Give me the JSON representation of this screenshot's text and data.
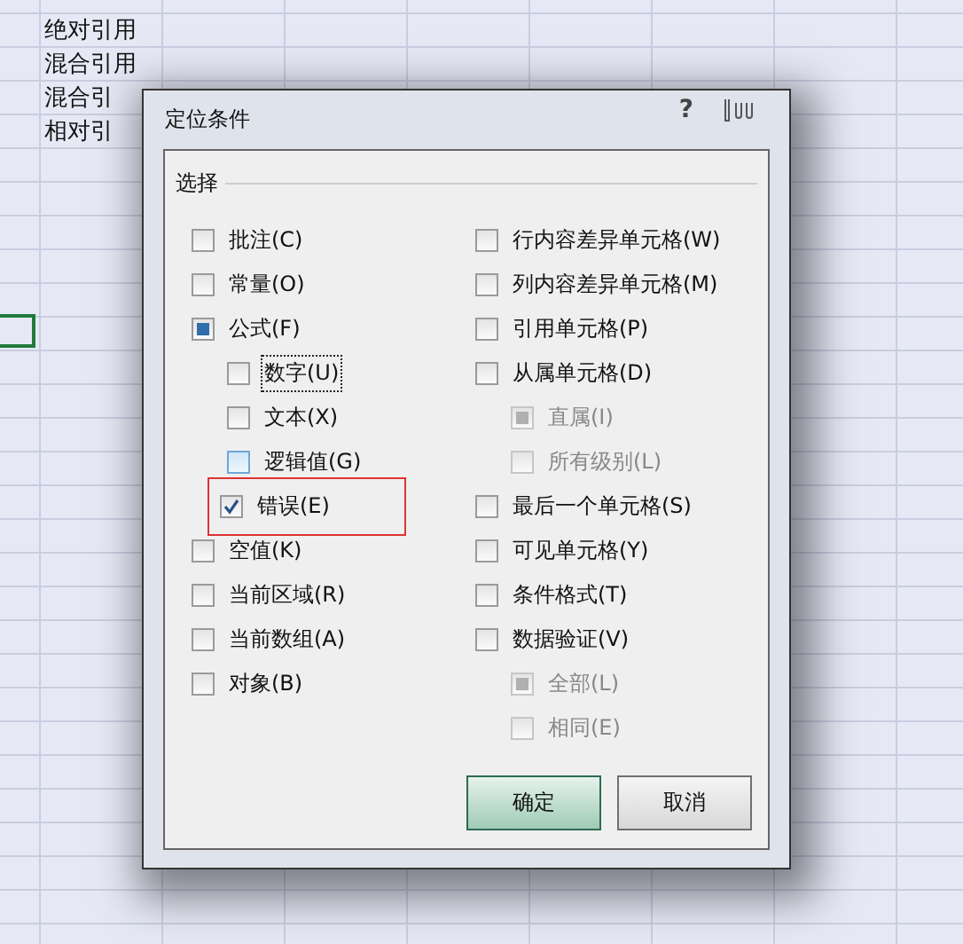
{
  "sheet": {
    "cells": [
      "绝对引用",
      "混合引用",
      "混合引",
      "相对引"
    ]
  },
  "dialog": {
    "title": "定位条件",
    "help": "?",
    "group_label": "选择",
    "left": [
      {
        "label": "批注(C)",
        "checked": false,
        "mixed": false,
        "disabled": false,
        "focused": false,
        "hovered": false,
        "highlighted": false
      },
      {
        "label": "常量(O)",
        "checked": false,
        "mixed": false,
        "disabled": false,
        "focused": false,
        "hovered": false,
        "highlighted": false
      },
      {
        "label": "公式(F)",
        "checked": false,
        "mixed": true,
        "disabled": false,
        "focused": false,
        "hovered": false,
        "highlighted": false,
        "children": [
          {
            "label": "数字(U)",
            "checked": false,
            "mixed": false,
            "disabled": false,
            "focused": true,
            "hovered": false,
            "highlighted": false
          },
          {
            "label": "文本(X)",
            "checked": false,
            "mixed": false,
            "disabled": false,
            "focused": false,
            "hovered": false,
            "highlighted": false
          },
          {
            "label": "逻辑值(G)",
            "checked": false,
            "mixed": false,
            "disabled": false,
            "focused": false,
            "hovered": true,
            "highlighted": false
          },
          {
            "label": "错误(E)",
            "checked": true,
            "mixed": false,
            "disabled": false,
            "focused": false,
            "hovered": false,
            "highlighted": true
          }
        ]
      },
      {
        "label": "空值(K)",
        "checked": false,
        "mixed": false,
        "disabled": false,
        "focused": false,
        "hovered": false,
        "highlighted": false
      },
      {
        "label": "当前区域(R)",
        "checked": false,
        "mixed": false,
        "disabled": false,
        "focused": false,
        "hovered": false,
        "highlighted": false
      },
      {
        "label": "当前数组(A)",
        "checked": false,
        "mixed": false,
        "disabled": false,
        "focused": false,
        "hovered": false,
        "highlighted": false
      },
      {
        "label": "对象(B)",
        "checked": false,
        "mixed": false,
        "disabled": false,
        "focused": false,
        "hovered": false,
        "highlighted": false
      }
    ],
    "right": [
      {
        "label": "行内容差异单元格(W)",
        "checked": false,
        "mixed": false,
        "disabled": false,
        "focused": false,
        "hovered": false,
        "highlighted": false
      },
      {
        "label": "列内容差异单元格(M)",
        "checked": false,
        "mixed": false,
        "disabled": false,
        "focused": false,
        "hovered": false,
        "highlighted": false
      },
      {
        "label": "引用单元格(P)",
        "checked": false,
        "mixed": false,
        "disabled": false,
        "focused": false,
        "hovered": false,
        "highlighted": false
      },
      {
        "label": "从属单元格(D)",
        "checked": false,
        "mixed": false,
        "disabled": false,
        "focused": false,
        "hovered": false,
        "highlighted": false,
        "children": [
          {
            "label": "直属(I)",
            "checked": false,
            "mixed": true,
            "disabled": true,
            "focused": false,
            "hovered": false,
            "highlighted": false
          },
          {
            "label": "所有级别(L)",
            "checked": false,
            "mixed": false,
            "disabled": true,
            "focused": false,
            "hovered": false,
            "highlighted": false
          }
        ]
      },
      {
        "label": "最后一个单元格(S)",
        "checked": false,
        "mixed": false,
        "disabled": false,
        "focused": false,
        "hovered": false,
        "highlighted": false
      },
      {
        "label": "可见单元格(Y)",
        "checked": false,
        "mixed": false,
        "disabled": false,
        "focused": false,
        "hovered": false,
        "highlighted": false
      },
      {
        "label": "条件格式(T)",
        "checked": false,
        "mixed": false,
        "disabled": false,
        "focused": false,
        "hovered": false,
        "highlighted": false
      },
      {
        "label": "数据验证(V)",
        "checked": false,
        "mixed": false,
        "disabled": false,
        "focused": false,
        "hovered": false,
        "highlighted": false,
        "children": [
          {
            "label": "全部(L)",
            "checked": false,
            "mixed": true,
            "disabled": true,
            "focused": false,
            "hovered": false,
            "highlighted": false
          },
          {
            "label": "相同(E)",
            "checked": false,
            "mixed": false,
            "disabled": true,
            "focused": false,
            "hovered": false,
            "highlighted": false
          }
        ]
      }
    ],
    "buttons": [
      {
        "label": "确定",
        "selected": true
      },
      {
        "label": "取消",
        "selected": false
      }
    ]
  }
}
